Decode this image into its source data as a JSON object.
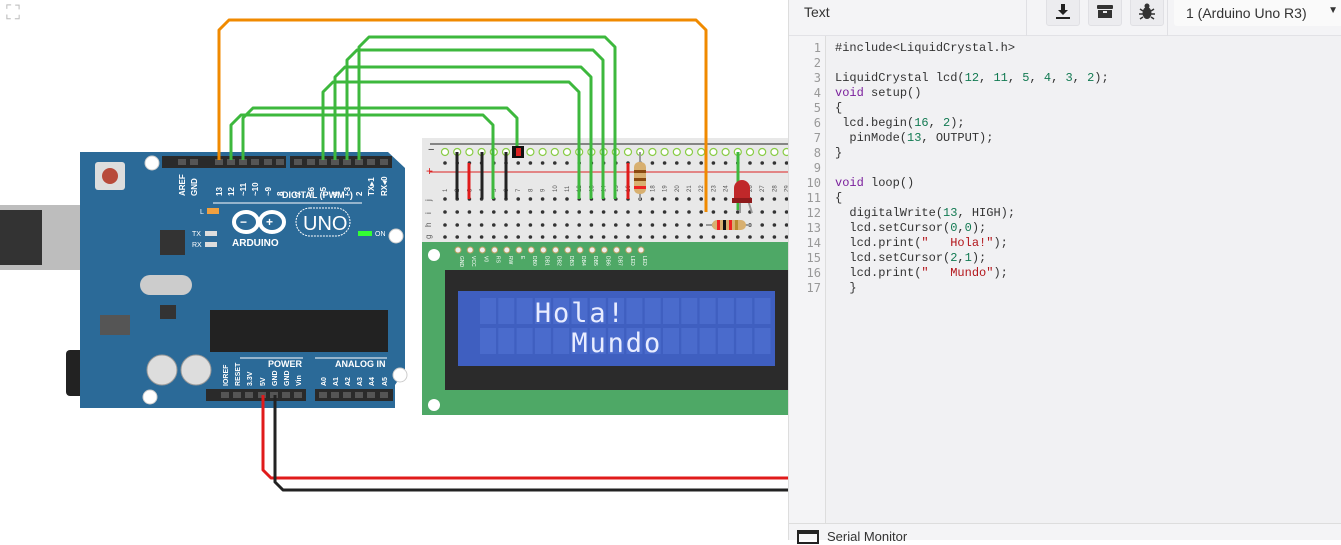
{
  "canvas": {
    "fit_icon": "fit-view-icon",
    "arduino": {
      "brand": "ARDUINO",
      "model": "UNO",
      "digital_label": "DIGITAL (PWM~)",
      "power_label": "POWER",
      "analog_label": "ANALOG IN",
      "on_label": "ON",
      "led_l": "L",
      "tx": "TX",
      "rx": "RX",
      "top_pins": [
        "AREF",
        "GND",
        "13",
        "12",
        "~11",
        "~10",
        "~9",
        "8",
        "7",
        "~6",
        "~5",
        "4",
        "~3",
        "2",
        "TX▸1",
        "RX◂0"
      ],
      "bottom_pins": [
        "IOREF",
        "RESET",
        "3.3V",
        "5V",
        "GND",
        "GND",
        "Vin",
        "A0",
        "A1",
        "A2",
        "A3",
        "A4",
        "A5"
      ]
    },
    "breadboard": {
      "rail_minus": "−",
      "rail_plus": "+",
      "columns": [
        "1",
        "2",
        "3",
        "4",
        "5",
        "6",
        "7",
        "8",
        "9",
        "10",
        "11",
        "12",
        "13",
        "14",
        "15",
        "16",
        "17",
        "18",
        "19",
        "20",
        "21",
        "22",
        "23",
        "24",
        "25",
        "26",
        "27",
        "28",
        "29"
      ],
      "rows": [
        "j",
        "i",
        "h",
        "g"
      ]
    },
    "lcd": {
      "pins": [
        "GND",
        "VCC",
        "V0",
        "RS",
        "RW",
        "E",
        "DB0",
        "DB1",
        "DB2",
        "DB3",
        "DB4",
        "DB5",
        "DB6",
        "DB7",
        "LED",
        "LED"
      ],
      "line1": "Hola!",
      "line2": " Mundo"
    },
    "colors": {
      "orange": "#f08a00",
      "green": "#3db83d",
      "red": "#e01b1b",
      "black": "#222222",
      "board": "#2b6a98",
      "lcd_board": "#4ea866",
      "lcd_screen": "#3f5fc0"
    }
  },
  "panel": {
    "mode": "Text",
    "download_icon": "download-icon",
    "library_icon": "library-icon",
    "debug_icon": "bug-icon",
    "device": "1 (Arduino Uno R3)",
    "code_lines": [
      "#include<LiquidCrystal.h>",
      "",
      "LiquidCrystal lcd(12, 11, 5, 4, 3, 2);",
      "void setup()",
      "{",
      " lcd.begin(16, 2);",
      "  pinMode(13, OUTPUT);",
      "}",
      "",
      "void loop()",
      "{",
      "  digitalWrite(13, HIGH);",
      "  lcd.setCursor(0,0);",
      "  lcd.print(\"   Hola!\");",
      "  lcd.setCursor(2,1);",
      "  lcd.print(\"   Mundo\");",
      "  }"
    ],
    "serial_monitor": "Serial Monitor"
  }
}
